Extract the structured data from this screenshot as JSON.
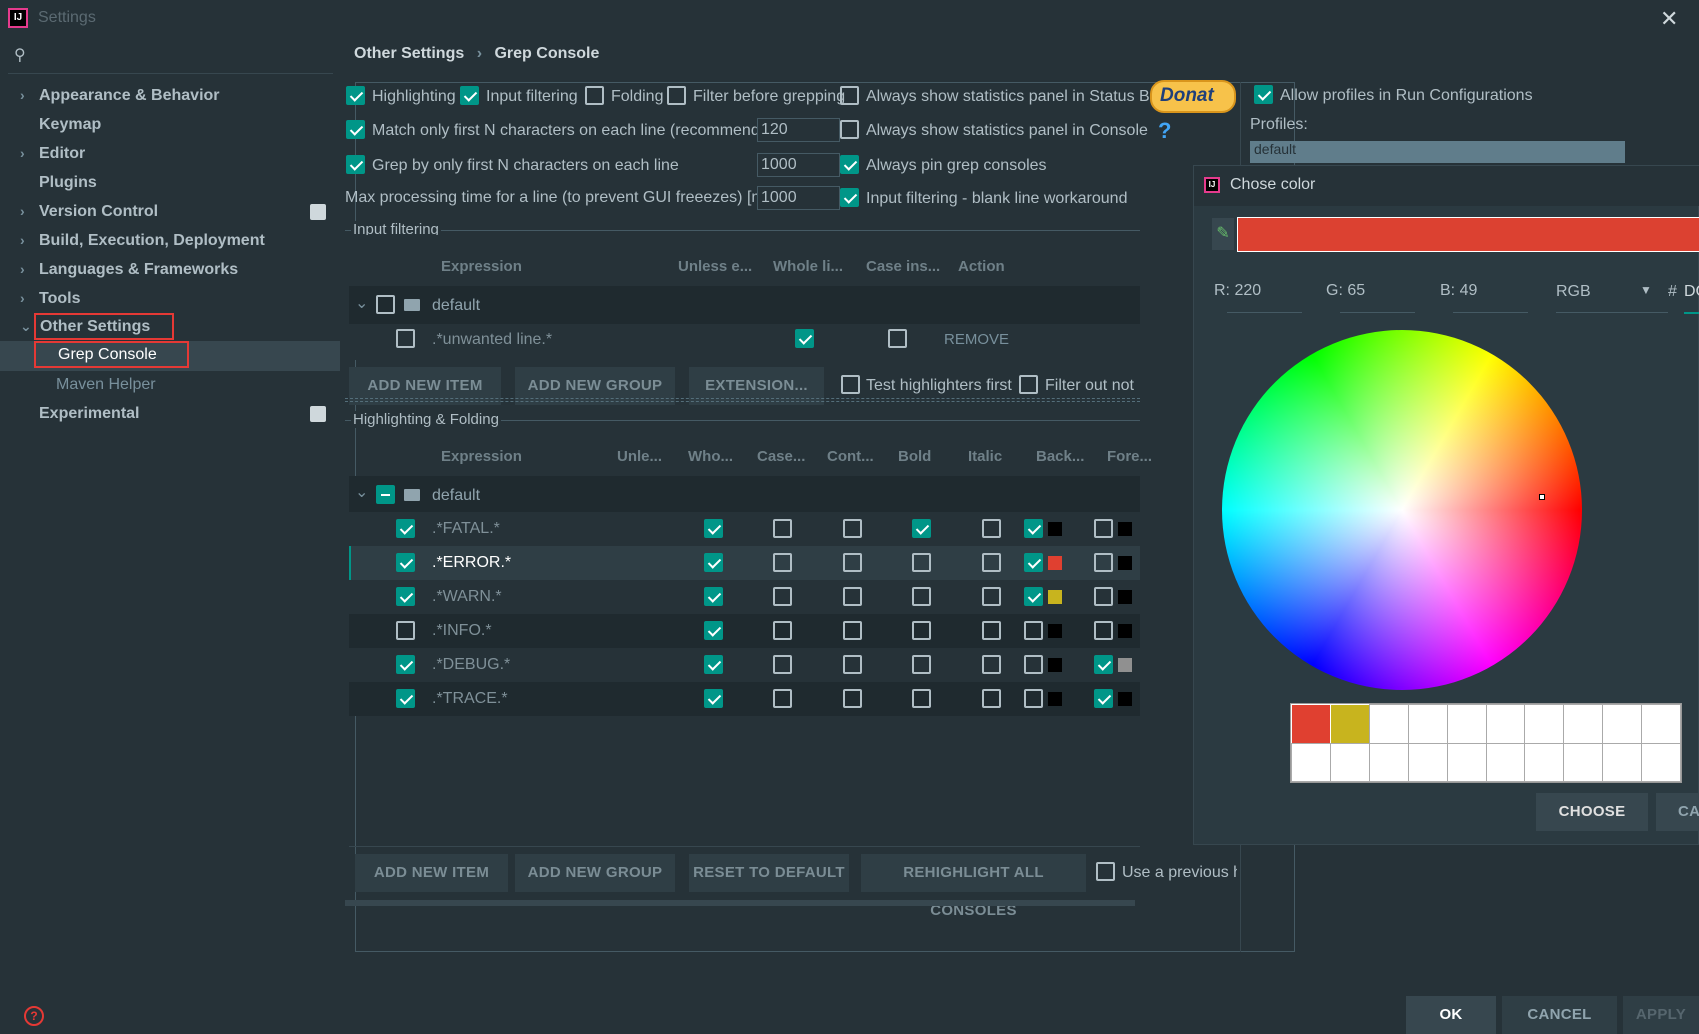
{
  "window": {
    "title": "Settings",
    "app_icon": "IJ",
    "close": "✕"
  },
  "search": {
    "icon": "⚲",
    "placeholder": ""
  },
  "sidebar": {
    "items": [
      {
        "label": "Appearance & Behavior",
        "arrow": "›"
      },
      {
        "label": "Keymap",
        "arrow": ""
      },
      {
        "label": "Editor",
        "arrow": "›"
      },
      {
        "label": "Plugins",
        "arrow": ""
      },
      {
        "label": "Version Control",
        "arrow": "›"
      },
      {
        "label": "Build, Execution, Deployment",
        "arrow": "›"
      },
      {
        "label": "Languages & Frameworks",
        "arrow": "›"
      },
      {
        "label": "Tools",
        "arrow": "›"
      },
      {
        "label": "Other Settings",
        "arrow": "⌄"
      },
      {
        "label": "Grep Console",
        "arrow": ""
      },
      {
        "label": "Maven Helper",
        "arrow": ""
      },
      {
        "label": "Experimental",
        "arrow": ""
      }
    ]
  },
  "breadcrumb": {
    "parent": "Other Settings",
    "sep": "›",
    "current": "Grep Console"
  },
  "options": {
    "highlighting": "Highlighting",
    "input_filtering": "Input filtering",
    "folding": "Folding",
    "filter_before": "Filter before grepping",
    "stats_status_bar": "Always show statistics panel in Status Bar",
    "match_first_n": "Match only first N characters on each line (recommended)",
    "match_first_n_value": "120",
    "stats_console": "Always show statistics panel in Console",
    "grep_first_n": "Grep by only first N characters on each line",
    "grep_first_n_value": "1000",
    "pin_consoles": "Always pin grep consoles",
    "max_time": "Max processing time for a line (to prevent GUI freeezes) [ms]",
    "max_time_value": "1000",
    "blank_line": "Input filtering - blank line workaround",
    "donate": "Donat",
    "help": "?"
  },
  "profiles": {
    "allow": "Allow profiles in Run Configurations",
    "label": "Profiles:",
    "first": "default"
  },
  "input_filtering": {
    "title": "Input filtering",
    "headers": [
      "Expression",
      "Unless e...",
      "Whole li...",
      "Case ins...",
      "Action"
    ],
    "group": "default",
    "row": {
      "expr": ".*unwanted line.*",
      "action": "REMOVE"
    },
    "buttons": [
      "ADD NEW ITEM",
      "ADD NEW GROUP",
      "EXTENSION..."
    ],
    "test_first": "Test highlighters first",
    "filter_out": "Filter out not"
  },
  "highlighting": {
    "title": "Highlighting & Folding",
    "headers": [
      "Expression",
      "Unle...",
      "Who...",
      "Case...",
      "Cont...",
      "Bold",
      "Italic",
      "Back...",
      "Fore..."
    ],
    "group": "default",
    "rows": [
      {
        "expr": ".*FATAL.*",
        "bg": "#000000",
        "fg": "#000000"
      },
      {
        "expr": ".*ERROR.*",
        "bg": "#e04030",
        "fg": "#000000"
      },
      {
        "expr": ".*WARN.*",
        "bg": "#c8b41e",
        "fg": "#000000"
      },
      {
        "expr": ".*INFO.*",
        "bg": "#000000",
        "fg": "#000000"
      },
      {
        "expr": ".*DEBUG.*",
        "bg": "#000000",
        "fg": "#909090"
      },
      {
        "expr": ".*TRACE.*",
        "bg": "#000000",
        "fg": "#000000"
      }
    ],
    "buttons": [
      "ADD NEW ITEM",
      "ADD NEW GROUP",
      "RESET TO DEFAULT",
      "REHIGHLIGHT ALL CONSOLES"
    ],
    "use_previous": "Use a previous hi"
  },
  "color_dialog": {
    "title": "Chose color",
    "selected_color": "#dc4131",
    "r_label": "R:",
    "r": "220",
    "g_label": "G:",
    "g": "65",
    "b_label": "B:",
    "b": "49",
    "mode": "RGB",
    "hash": "#",
    "hex_partial": "DC",
    "recent": [
      "#e04030",
      "#c8b41e"
    ],
    "choose": "CHOOSE",
    "cancel": "CA"
  },
  "footer": {
    "help": "?",
    "ok": "OK",
    "cancel": "CANCEL",
    "apply": "APPLY"
  },
  "colors": {
    "accent": "#009688",
    "bg": "#263238",
    "red": "#e53935"
  }
}
